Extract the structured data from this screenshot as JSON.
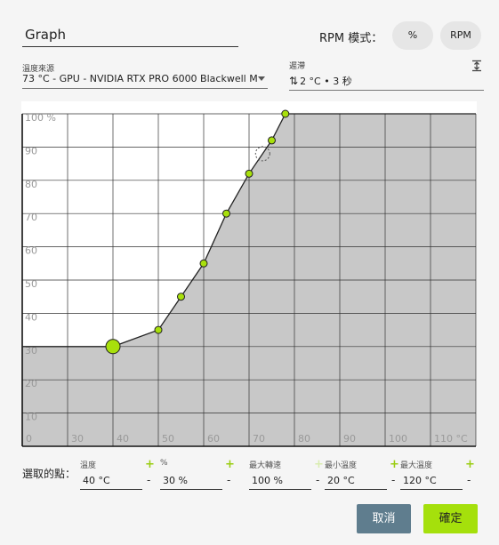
{
  "header": {
    "name_value": "Graph",
    "rpm_mode_label": "RPM 模式：",
    "mode_percent": "%",
    "mode_rpm": "RPM"
  },
  "temp_source": {
    "caption": "溫度來源",
    "value": "73 °C - GPU - NVIDIA RTX PRO 6000 Blackwell M"
  },
  "delay": {
    "caption": "遲滯",
    "value": "2 °C • 3 秒",
    "icon": "up-down-arrows-icon"
  },
  "chart_data": {
    "type": "line",
    "x_ticks": [
      "0",
      "30",
      "40",
      "50",
      "60",
      "70",
      "80",
      "90",
      "100",
      "110 °C"
    ],
    "y_ticks": [
      "10",
      "20",
      "30",
      "40",
      "50",
      "60",
      "70",
      "80",
      "90",
      "100 %"
    ],
    "xlim": [
      20,
      120
    ],
    "ylim": [
      0,
      100
    ],
    "points": [
      {
        "x": 20,
        "y": 30
      },
      {
        "x": 40,
        "y": 30
      },
      {
        "x": 50,
        "y": 35
      },
      {
        "x": 55,
        "y": 45
      },
      {
        "x": 60,
        "y": 55
      },
      {
        "x": 65,
        "y": 70
      },
      {
        "x": 70,
        "y": 82
      },
      {
        "x": 75,
        "y": 92
      },
      {
        "x": 78,
        "y": 100
      },
      {
        "x": 120,
        "y": 100
      }
    ],
    "control_points": [
      {
        "x": 40,
        "y": 30,
        "selected": true
      },
      {
        "x": 50,
        "y": 35
      },
      {
        "x": 55,
        "y": 45
      },
      {
        "x": 60,
        "y": 55
      },
      {
        "x": 65,
        "y": 70
      },
      {
        "x": 70,
        "y": 82
      },
      {
        "x": 75,
        "y": 92
      },
      {
        "x": 78,
        "y": 100
      }
    ],
    "current_marker": {
      "x": 73,
      "y": 88
    },
    "colors": {
      "fill": "#c8c8c8",
      "point": "#a8e00c",
      "line": "#222222",
      "grid": "#333333"
    }
  },
  "selected_point": {
    "label": "選取的點：",
    "fields": [
      {
        "caption": "溫度",
        "value": "40 °C"
      },
      {
        "caption": "%",
        "value": "30 %"
      },
      {
        "caption": "最大轉速",
        "value": "100 %"
      },
      {
        "caption": "最小溫度",
        "value": "20 °C"
      },
      {
        "caption": "最大溫度",
        "value": "120 °C"
      }
    ],
    "plus": "+",
    "minus": "-"
  },
  "buttons": {
    "cancel": "取消",
    "confirm": "確定"
  },
  "colors": {
    "accent": "#a5e00c",
    "cancel_bg": "#5f7d8e",
    "bg": "#f5f5f5"
  }
}
